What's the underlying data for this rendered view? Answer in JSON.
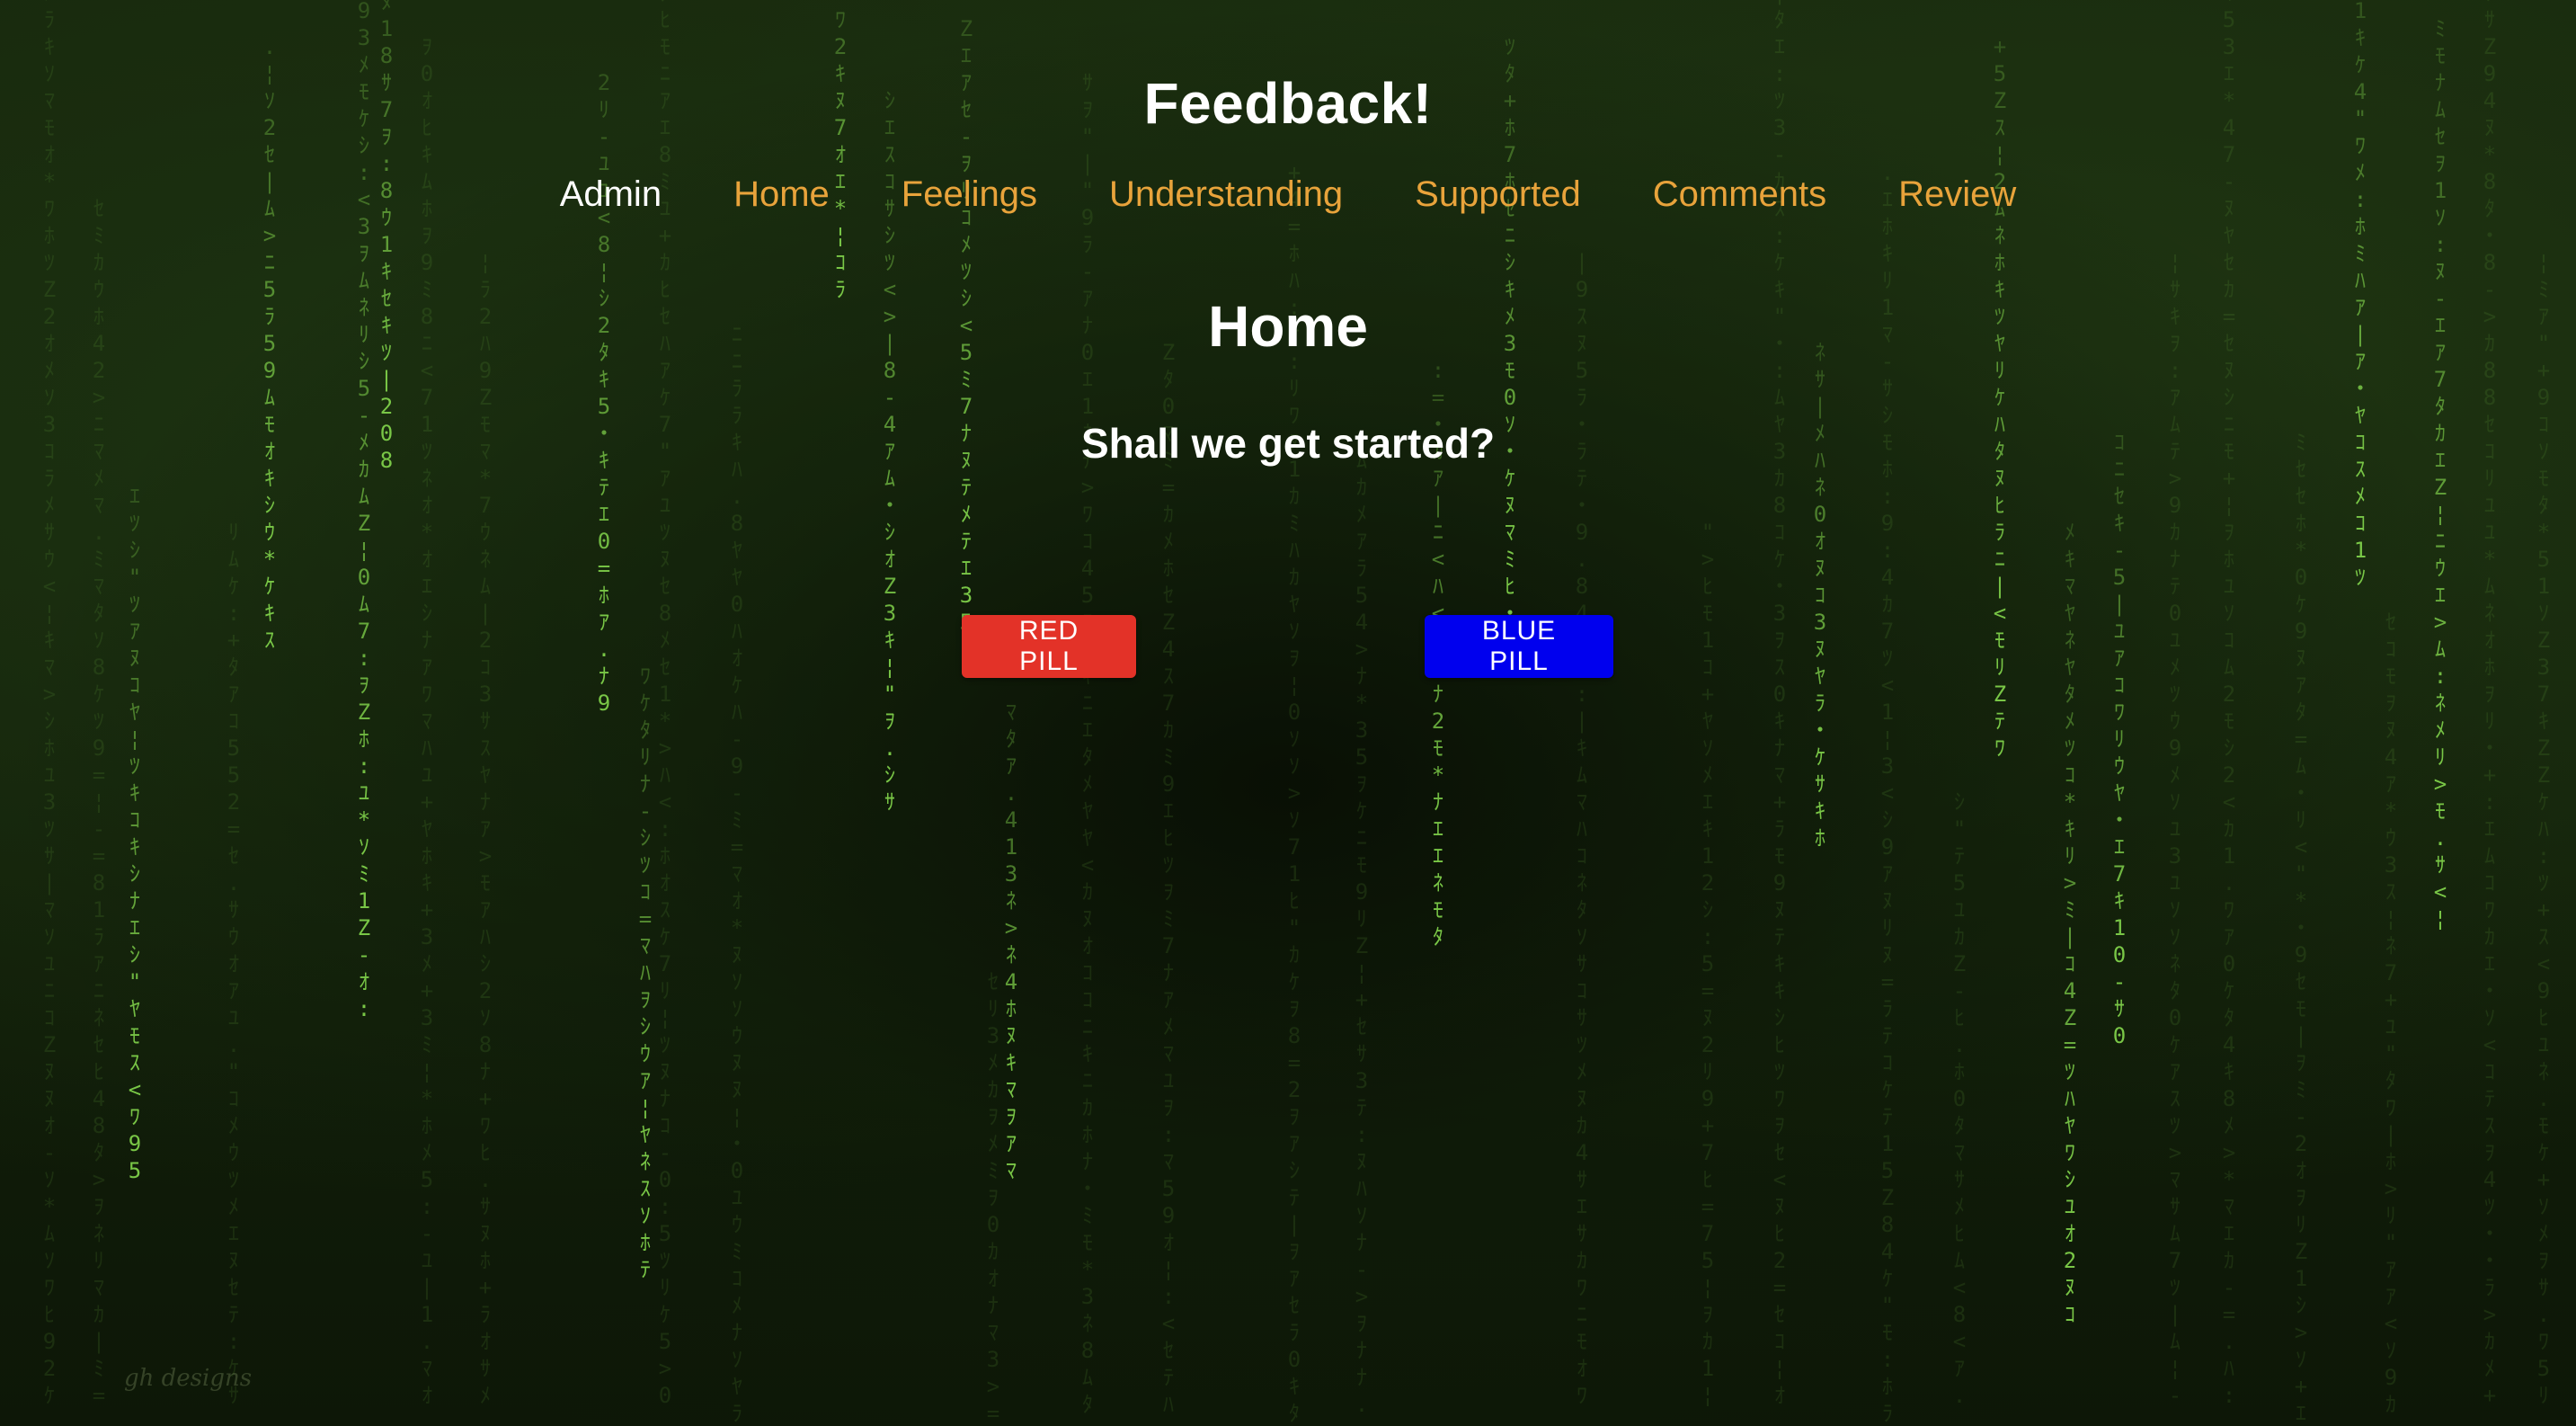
{
  "header": {
    "title": "Feedback!"
  },
  "nav": {
    "items": [
      {
        "label": "Admin",
        "active": true
      },
      {
        "label": "Home",
        "active": false
      },
      {
        "label": "Feelings",
        "active": false
      },
      {
        "label": "Understanding",
        "active": false
      },
      {
        "label": "Supported",
        "active": false
      },
      {
        "label": "Comments",
        "active": false
      },
      {
        "label": "Review",
        "active": false
      }
    ]
  },
  "main": {
    "page_title": "Home",
    "prompt": "Shall we get started?",
    "buttons": {
      "red_label": "RED PILL",
      "blue_label": "BLUE PILL"
    }
  },
  "background": {
    "signature": "gh designs"
  },
  "colors": {
    "nav_link": "#e8a33b",
    "nav_active": "#ffffff",
    "red_pill": "#e33228",
    "blue_pill": "#0000ee",
    "rain_glyph": "#7fd04a"
  }
}
